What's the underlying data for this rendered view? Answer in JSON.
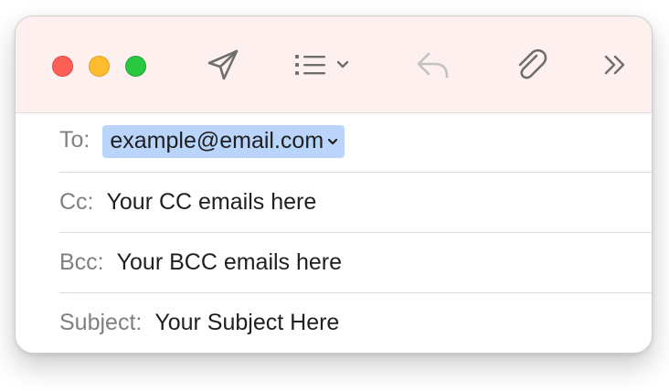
{
  "toolbar": {
    "buttons": [
      {
        "name": "send",
        "icon": "paper-plane-icon"
      },
      {
        "name": "format-list",
        "icon": "list-icon"
      },
      {
        "name": "reply",
        "icon": "reply-arrow-icon",
        "enabled": false
      },
      {
        "name": "attach",
        "icon": "paperclip-icon"
      },
      {
        "name": "more",
        "icon": "double-chevron-right-icon"
      }
    ]
  },
  "fields": {
    "to": {
      "label": "To:",
      "recipient": "example@email.com"
    },
    "cc": {
      "label": "Cc:",
      "value": "Your CC emails here"
    },
    "bcc": {
      "label": "Bcc:",
      "value": "Your BCC emails here"
    },
    "subject": {
      "label": "Subject:",
      "value": "Your Subject Here"
    }
  },
  "colors": {
    "toolbar_bg": "#fdf0ee",
    "close": "#fe5f57",
    "minimize": "#febc2e",
    "maximize": "#28c840",
    "token_bg": "#b9d5fb",
    "label_gray": "#808080"
  }
}
